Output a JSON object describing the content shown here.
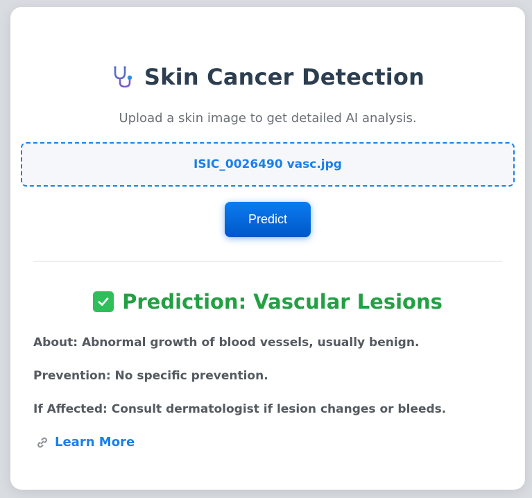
{
  "header": {
    "title": "Skin Cancer Detection",
    "title_icon": "stethoscope-icon",
    "subtitle": "Upload a skin image to get detailed AI analysis."
  },
  "upload": {
    "file_name": "ISIC_0026490 vasc.jpg"
  },
  "actions": {
    "predict_label": "Predict"
  },
  "result": {
    "status_icon": "check-icon",
    "prediction": "Prediction: Vascular Lesions",
    "about": "About: Abnormal growth of blood vessels, usually benign.",
    "prevention": "Prevention: No specific prevention.",
    "if_affected": "If Affected: Consult dermatologist if lesion changes or bleeds.",
    "link_icon": "link-icon",
    "learn_more": "Learn More"
  },
  "colors": {
    "accent": "#1a7fe8",
    "success": "#22a043",
    "title": "#2c3e50",
    "background": "#d9dde2"
  }
}
